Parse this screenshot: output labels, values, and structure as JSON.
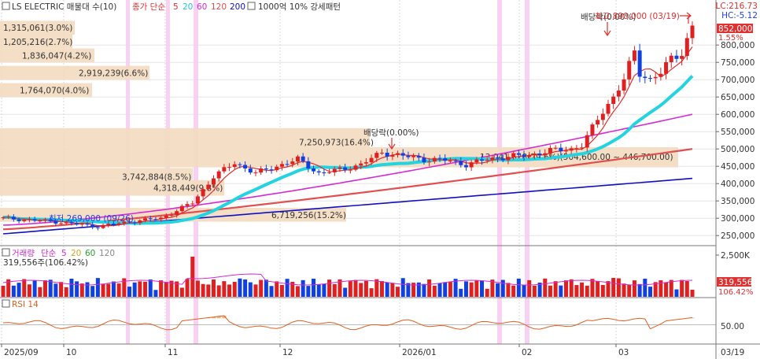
{
  "header": {
    "title_prefix": "LS ELECTRIC 매물대 수(10)",
    "ma_label": "종가 단순",
    "ma_periods": [
      "5",
      "20",
      "60",
      "120",
      "200"
    ],
    "ma_colors": [
      "#e03030",
      "#22d3e0",
      "#d62ad6",
      "#e05050",
      "#1010c0"
    ],
    "pattern_label": "1000억 10% 강세패턴",
    "lc": "LC:216.73",
    "hc": "HC:-5.12"
  },
  "volume_header": {
    "label": "거래량",
    "ma_label": "단순",
    "periods": [
      "5",
      "20",
      "60",
      "120"
    ],
    "period_colors": [
      "#d62ad6",
      "#d6a020",
      "#2aa02a",
      "#888888"
    ],
    "current": "319,556주(106.42%)"
  },
  "rsi_header": {
    "label": "RSI 14"
  },
  "price_axis": {
    "ticks": [
      "800,000",
      "750,000",
      "700,000",
      "650,000",
      "600,000",
      "550,000",
      "500,000",
      "450,000",
      "400,000",
      "350,000",
      "300,000",
      "250,000"
    ],
    "current_price": "852,000",
    "current_pct": "1.55%"
  },
  "volume_axis": {
    "tick": "2,500K",
    "current": "319,556",
    "current_pct": "106.42%"
  },
  "rsi_axis": {
    "tick": "50.00"
  },
  "x_axis": {
    "labels": [
      "2025/09",
      "10",
      "11",
      "12",
      "2026/01",
      "02",
      "03"
    ],
    "end_label": "03/19"
  },
  "volume_profile": [
    {
      "label": "1,315,061(3.0%)"
    },
    {
      "label": "1,205,216(2.7%)"
    },
    {
      "label": "1,836,047(4.2%)"
    },
    {
      "label": "2,919,239(6.6%)"
    },
    {
      "label": "1,764,070(4.0%)"
    },
    {
      "label": "7,250,973(16.4%)"
    },
    {
      "label": "13,041,628(29.6%)(504,600.00 ~ 446,700.00)"
    },
    {
      "label": "3,742,884(8.5%)"
    },
    {
      "label": "4,318,449(9.8%)"
    },
    {
      "label": "6,719,256(15.2%)"
    }
  ],
  "annotations": {
    "low": "최저 269,000 (09/26)",
    "high": "최고 890,000 (03/19)",
    "dividend_1": "배당락(0.00%)",
    "dividend_2": "배당락(0.00%)"
  },
  "chart_data": {
    "type": "candlestick",
    "title": "LS ELECTRIC",
    "series": [
      {
        "name": "종가 단순 5"
      },
      {
        "name": "종가 단순 20"
      },
      {
        "name": "종가 단순 60"
      },
      {
        "name": "종가 단순 120"
      },
      {
        "name": "종가 단순 200"
      }
    ],
    "x_range": [
      "2025/09",
      "03/19"
    ],
    "ylim": [
      230000,
      880000
    ],
    "key_points": [
      {
        "date": "2025/09",
        "close": 300000
      },
      {
        "date": "09/26",
        "low": 269000
      },
      {
        "date": "10",
        "close": 290000
      },
      {
        "date": "11",
        "close": 460000
      },
      {
        "date": "12",
        "close": 470000
      },
      {
        "date": "2026/01",
        "close": 490000
      },
      {
        "date": "02",
        "close": 540000
      },
      {
        "date": "03",
        "close": 700000
      },
      {
        "date": "03/19",
        "close": 852000,
        "high": 890000
      }
    ],
    "last_close": 852000,
    "last_change_pct": 1.55,
    "last_volume": 319556,
    "volume_ylim": [
      0,
      2500000
    ],
    "rsi_reference": 50
  }
}
